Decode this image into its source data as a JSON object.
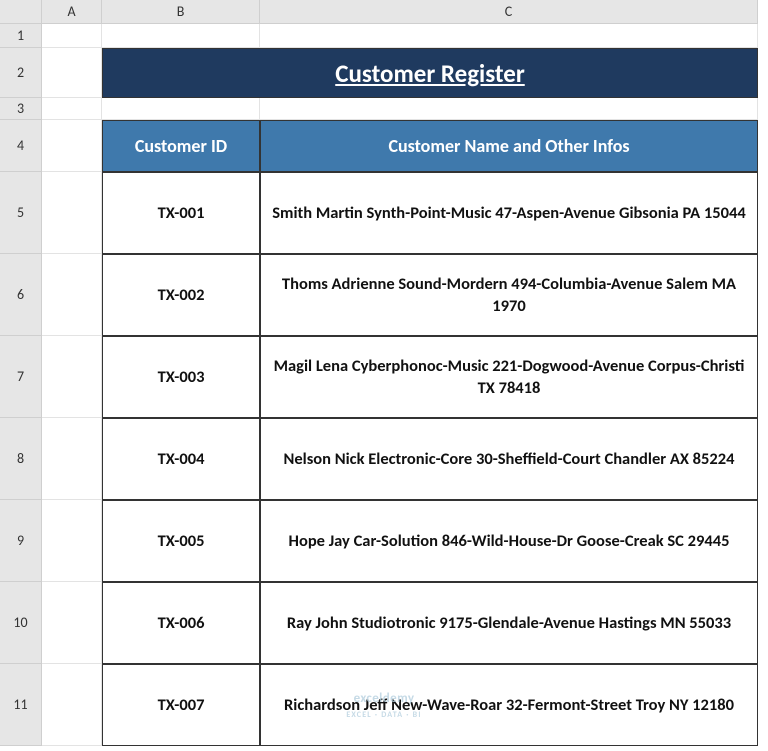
{
  "columns": [
    "A",
    "B",
    "C"
  ],
  "rows": [
    "1",
    "2",
    "3",
    "4",
    "5",
    "6",
    "7",
    "8",
    "9",
    "10",
    "11"
  ],
  "title": "Customer Register",
  "headers": {
    "id": "Customer ID",
    "info": "Customer Name and Other Infos"
  },
  "records": [
    {
      "id": "TX-001",
      "info": "Smith Martin Synth-Point-Music 47-Aspen-Avenue Gibsonia PA 15044"
    },
    {
      "id": "TX-002",
      "info": "Thoms Adrienne Sound-Mordern 494-Columbia-Avenue Salem MA 1970"
    },
    {
      "id": "TX-003",
      "info": "Magil Lena Cyberphonoc-Music 221-Dogwood-Avenue Corpus-Christi TX 78418"
    },
    {
      "id": "TX-004",
      "info": "Nelson Nick Electronic-Core 30-Sheffield-Court Chandler AX 85224"
    },
    {
      "id": "TX-005",
      "info": "Hope Jay Car-Solution 846-Wild-House-Dr Goose-Creak SC 29445"
    },
    {
      "id": "TX-006",
      "info": "Ray John Studiotronic 9175-Glendale-Avenue Hastings MN 55033"
    },
    {
      "id": "TX-007",
      "info": "Richardson Jeff New-Wave-Roar 32-Fermont-Street Troy NY 12180"
    }
  ],
  "watermark": {
    "brand": "exceldemy",
    "tag": "EXCEL · DATA · BI"
  },
  "chart_data": {
    "type": "table",
    "title": "Customer Register",
    "columns": [
      "Customer ID",
      "Customer Name and Other Infos"
    ],
    "rows": [
      [
        "TX-001",
        "Smith Martin Synth-Point-Music 47-Aspen-Avenue Gibsonia PA 15044"
      ],
      [
        "TX-002",
        "Thoms Adrienne Sound-Mordern 494-Columbia-Avenue Salem MA 1970"
      ],
      [
        "TX-003",
        "Magil Lena Cyberphonoc-Music 221-Dogwood-Avenue Corpus-Christi TX 78418"
      ],
      [
        "TX-004",
        "Nelson Nick Electronic-Core 30-Sheffield-Court Chandler AX 85224"
      ],
      [
        "TX-005",
        "Hope Jay Car-Solution 846-Wild-House-Dr Goose-Creak SC 29445"
      ],
      [
        "TX-006",
        "Ray John Studiotronic 9175-Glendale-Avenue Hastings MN 55033"
      ],
      [
        "TX-007",
        "Richardson Jeff New-Wave-Roar 32-Fermont-Street Troy NY 12180"
      ]
    ]
  }
}
